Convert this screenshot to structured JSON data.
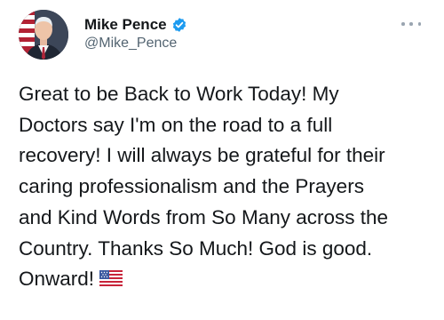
{
  "author": {
    "display_name": "Mike Pence",
    "handle": "@Mike_Pence",
    "verified": true
  },
  "tweet": {
    "lines": [
      "Great to be Back to Work Today! My",
      "Doctors say I'm on the road to a full",
      "recovery! I will always be grateful for their",
      "caring professionalism and the Prayers",
      "and Kind Words from So Many across the",
      "Country. Thanks So Much! God is good.",
      "Onward!"
    ],
    "emoji": "us-flag-emoji"
  },
  "icons": {
    "more": "more-options-icon",
    "verified": "verified-badge-icon"
  },
  "colors": {
    "text": "#14171a",
    "secondary": "#536471",
    "verified": "#1d9bf0"
  }
}
